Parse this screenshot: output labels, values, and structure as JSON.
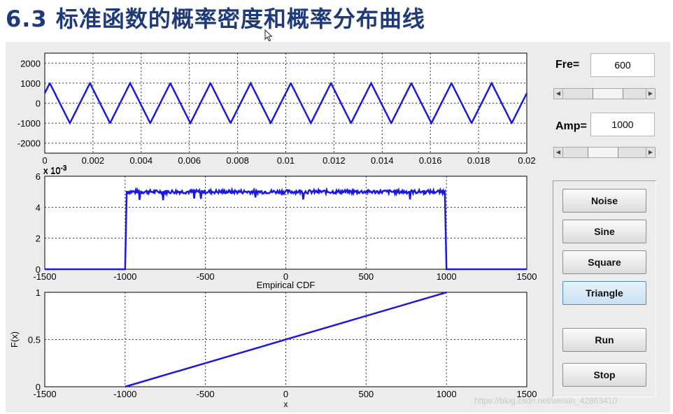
{
  "slide": {
    "title": "6.3 标准函数的概率密度和概率分布曲线",
    "watermark": "https://blog.csdn.net/weixin_42863410"
  },
  "controls": {
    "fre": {
      "label": "Fre=",
      "value": "600",
      "slider_fraction": 0.56
    },
    "amp": {
      "label": "Amp=",
      "value": "1000",
      "slider_fraction": 0.48
    }
  },
  "buttons": [
    {
      "id": "noise",
      "label": "Noise"
    },
    {
      "id": "sine",
      "label": "Sine"
    },
    {
      "id": "square",
      "label": "Square"
    },
    {
      "id": "triangle",
      "label": "Triangle",
      "hovered": true
    },
    {
      "id": "run",
      "label": "Run"
    },
    {
      "id": "stop",
      "label": "Stop"
    }
  ],
  "colors": {
    "line": "#1a1adf",
    "axes_bg": "#ffffff",
    "window_bg": "#ececec",
    "title": "#1f3a7a"
  },
  "chart_data": [
    {
      "type": "line",
      "title": "",
      "xlabel": "",
      "ylabel": "",
      "x_exponent": "x 10",
      "x_exponent_power": "-3",
      "xlim": [
        0,
        0.02
      ],
      "ylim": [
        -2500,
        2500
      ],
      "xticks": [
        "0",
        "0.002",
        "0.004",
        "0.006",
        "0.008",
        "0.01",
        "0.012",
        "0.014",
        "0.016",
        "0.018",
        "0.02"
      ],
      "yticks": [
        "2000",
        "1000",
        "0",
        "-1000",
        "-2000"
      ],
      "grid": true,
      "series": [
        {
          "type": "triangle-wave",
          "frequency": 600,
          "amplitude": 1000,
          "x_start": 0,
          "x_end": 0.02,
          "initial_value": 500
        }
      ]
    },
    {
      "type": "line",
      "title": "",
      "xlabel": "",
      "ylabel": "",
      "xlim": [
        -1500,
        1500
      ],
      "ylim": [
        0,
        6
      ],
      "y_exponent": "x 10",
      "y_exponent_power": "-3",
      "xticks": [
        "-1500",
        "-1000",
        "-500",
        "0",
        "500",
        "1000",
        "1500"
      ],
      "yticks": [
        "6",
        "4",
        "2",
        "0"
      ],
      "grid": true,
      "series": [
        {
          "x": [
            -1500,
            -1000,
            -990,
            990,
            1000,
            1500
          ],
          "y": [
            0,
            0,
            5,
            5,
            0,
            0
          ],
          "noise_level": 0.12
        }
      ]
    },
    {
      "type": "line",
      "title": "Empirical CDF",
      "xlabel": "x",
      "ylabel": "F(x)",
      "xlim": [
        -1500,
        1500
      ],
      "ylim": [
        0,
        1
      ],
      "xticks": [
        "-1500",
        "-1000",
        "-500",
        "0",
        "500",
        "1000",
        "1500"
      ],
      "yticks": [
        "1",
        "0.5",
        "0"
      ],
      "grid": true,
      "series": [
        {
          "x": [
            -1000,
            1000
          ],
          "y": [
            0,
            1
          ]
        }
      ]
    }
  ]
}
